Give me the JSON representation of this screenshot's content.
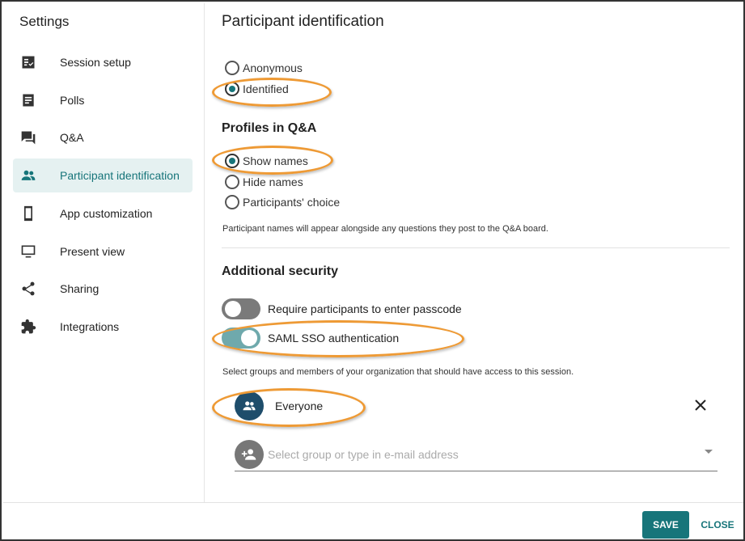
{
  "sidebar": {
    "title": "Settings",
    "items": [
      {
        "label": "Session setup",
        "icon": "checklist-icon"
      },
      {
        "label": "Polls",
        "icon": "poll-icon"
      },
      {
        "label": "Q&A",
        "icon": "qa-icon"
      },
      {
        "label": "Participant identification",
        "icon": "people-icon",
        "active": true
      },
      {
        "label": "App customization",
        "icon": "phone-icon"
      },
      {
        "label": "Present view",
        "icon": "monitor-icon"
      },
      {
        "label": "Sharing",
        "icon": "share-icon"
      },
      {
        "label": "Integrations",
        "icon": "puzzle-icon"
      }
    ]
  },
  "main": {
    "title": "Participant identification",
    "identification": {
      "options": [
        "Anonymous",
        "Identified"
      ],
      "selected": "Identified"
    },
    "profiles": {
      "title": "Profiles in Q&A",
      "options": [
        "Show names",
        "Hide names",
        "Participants' choice"
      ],
      "selected": "Show names",
      "hint": "Participant names will appear alongside any questions they post to the Q&A board."
    },
    "security": {
      "title": "Additional security",
      "passcode_label": "Require participants to enter passcode",
      "passcode_on": false,
      "sso_label": "SAML SSO authentication",
      "sso_on": true,
      "hint": "Select groups and members of your organization that should have access to this session.",
      "member": "Everyone",
      "select_placeholder": "Select group or type in e-mail address"
    }
  },
  "footer": {
    "save_label": "SAVE",
    "close_label": "CLOSE"
  },
  "colors": {
    "accent": "#17757a",
    "highlight": "#ee9a35",
    "active_bg": "#e5f1f1"
  }
}
